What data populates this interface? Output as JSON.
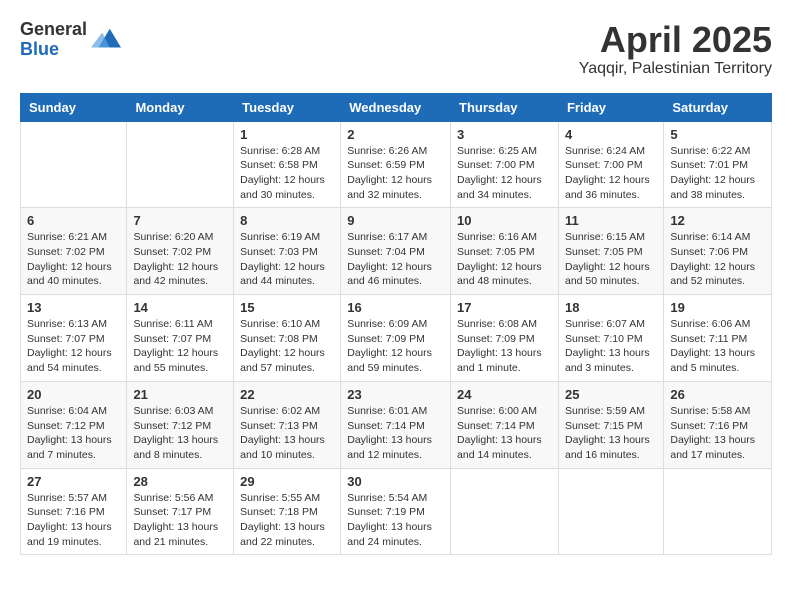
{
  "logo": {
    "general": "General",
    "blue": "Blue"
  },
  "title": "April 2025",
  "subtitle": "Yaqqir, Palestinian Territory",
  "days_header": [
    "Sunday",
    "Monday",
    "Tuesday",
    "Wednesday",
    "Thursday",
    "Friday",
    "Saturday"
  ],
  "weeks": [
    [
      {
        "day": "",
        "detail": ""
      },
      {
        "day": "",
        "detail": ""
      },
      {
        "day": "1",
        "detail": "Sunrise: 6:28 AM\nSunset: 6:58 PM\nDaylight: 12 hours\nand 30 minutes."
      },
      {
        "day": "2",
        "detail": "Sunrise: 6:26 AM\nSunset: 6:59 PM\nDaylight: 12 hours\nand 32 minutes."
      },
      {
        "day": "3",
        "detail": "Sunrise: 6:25 AM\nSunset: 7:00 PM\nDaylight: 12 hours\nand 34 minutes."
      },
      {
        "day": "4",
        "detail": "Sunrise: 6:24 AM\nSunset: 7:00 PM\nDaylight: 12 hours\nand 36 minutes."
      },
      {
        "day": "5",
        "detail": "Sunrise: 6:22 AM\nSunset: 7:01 PM\nDaylight: 12 hours\nand 38 minutes."
      }
    ],
    [
      {
        "day": "6",
        "detail": "Sunrise: 6:21 AM\nSunset: 7:02 PM\nDaylight: 12 hours\nand 40 minutes."
      },
      {
        "day": "7",
        "detail": "Sunrise: 6:20 AM\nSunset: 7:02 PM\nDaylight: 12 hours\nand 42 minutes."
      },
      {
        "day": "8",
        "detail": "Sunrise: 6:19 AM\nSunset: 7:03 PM\nDaylight: 12 hours\nand 44 minutes."
      },
      {
        "day": "9",
        "detail": "Sunrise: 6:17 AM\nSunset: 7:04 PM\nDaylight: 12 hours\nand 46 minutes."
      },
      {
        "day": "10",
        "detail": "Sunrise: 6:16 AM\nSunset: 7:05 PM\nDaylight: 12 hours\nand 48 minutes."
      },
      {
        "day": "11",
        "detail": "Sunrise: 6:15 AM\nSunset: 7:05 PM\nDaylight: 12 hours\nand 50 minutes."
      },
      {
        "day": "12",
        "detail": "Sunrise: 6:14 AM\nSunset: 7:06 PM\nDaylight: 12 hours\nand 52 minutes."
      }
    ],
    [
      {
        "day": "13",
        "detail": "Sunrise: 6:13 AM\nSunset: 7:07 PM\nDaylight: 12 hours\nand 54 minutes."
      },
      {
        "day": "14",
        "detail": "Sunrise: 6:11 AM\nSunset: 7:07 PM\nDaylight: 12 hours\nand 55 minutes."
      },
      {
        "day": "15",
        "detail": "Sunrise: 6:10 AM\nSunset: 7:08 PM\nDaylight: 12 hours\nand 57 minutes."
      },
      {
        "day": "16",
        "detail": "Sunrise: 6:09 AM\nSunset: 7:09 PM\nDaylight: 12 hours\nand 59 minutes."
      },
      {
        "day": "17",
        "detail": "Sunrise: 6:08 AM\nSunset: 7:09 PM\nDaylight: 13 hours\nand 1 minute."
      },
      {
        "day": "18",
        "detail": "Sunrise: 6:07 AM\nSunset: 7:10 PM\nDaylight: 13 hours\nand 3 minutes."
      },
      {
        "day": "19",
        "detail": "Sunrise: 6:06 AM\nSunset: 7:11 PM\nDaylight: 13 hours\nand 5 minutes."
      }
    ],
    [
      {
        "day": "20",
        "detail": "Sunrise: 6:04 AM\nSunset: 7:12 PM\nDaylight: 13 hours\nand 7 minutes."
      },
      {
        "day": "21",
        "detail": "Sunrise: 6:03 AM\nSunset: 7:12 PM\nDaylight: 13 hours\nand 8 minutes."
      },
      {
        "day": "22",
        "detail": "Sunrise: 6:02 AM\nSunset: 7:13 PM\nDaylight: 13 hours\nand 10 minutes."
      },
      {
        "day": "23",
        "detail": "Sunrise: 6:01 AM\nSunset: 7:14 PM\nDaylight: 13 hours\nand 12 minutes."
      },
      {
        "day": "24",
        "detail": "Sunrise: 6:00 AM\nSunset: 7:14 PM\nDaylight: 13 hours\nand 14 minutes."
      },
      {
        "day": "25",
        "detail": "Sunrise: 5:59 AM\nSunset: 7:15 PM\nDaylight: 13 hours\nand 16 minutes."
      },
      {
        "day": "26",
        "detail": "Sunrise: 5:58 AM\nSunset: 7:16 PM\nDaylight: 13 hours\nand 17 minutes."
      }
    ],
    [
      {
        "day": "27",
        "detail": "Sunrise: 5:57 AM\nSunset: 7:16 PM\nDaylight: 13 hours\nand 19 minutes."
      },
      {
        "day": "28",
        "detail": "Sunrise: 5:56 AM\nSunset: 7:17 PM\nDaylight: 13 hours\nand 21 minutes."
      },
      {
        "day": "29",
        "detail": "Sunrise: 5:55 AM\nSunset: 7:18 PM\nDaylight: 13 hours\nand 22 minutes."
      },
      {
        "day": "30",
        "detail": "Sunrise: 5:54 AM\nSunset: 7:19 PM\nDaylight: 13 hours\nand 24 minutes."
      },
      {
        "day": "",
        "detail": ""
      },
      {
        "day": "",
        "detail": ""
      },
      {
        "day": "",
        "detail": ""
      }
    ]
  ]
}
